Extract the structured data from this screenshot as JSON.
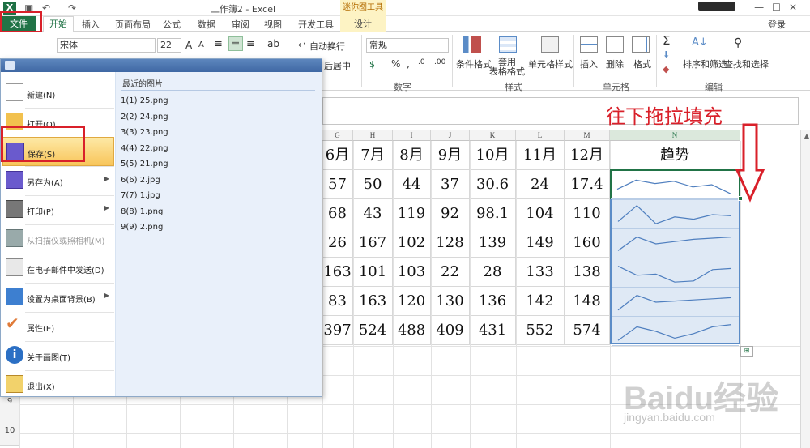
{
  "window": {
    "title": "工作簿2 - Excel",
    "context_tools_label": "迷你图工具",
    "minimize": "—",
    "restore": "☐",
    "close": "✕"
  },
  "tabs": {
    "file": "文件",
    "home": "开始",
    "insert": "插入",
    "page_layout": "页面布局",
    "formulas": "公式",
    "data": "数据",
    "review": "审阅",
    "view": "视图",
    "developer": "开发工具",
    "design": "设计",
    "login": "登录"
  },
  "ribbon": {
    "font_name": "宋体",
    "font_size": "22",
    "font_grow": "A",
    "font_shrink": "A",
    "wrap_text": "自动换行",
    "merge_center": "后居中",
    "number_format": "常规",
    "percent": "%",
    "comma": ",",
    "conditional_format": "条件格式",
    "table_format": "套用\n表格格式",
    "cell_styles": "单元格样式",
    "insert": "插入",
    "delete": "删除",
    "format": "格式",
    "sort_filter": "排序和筛选",
    "find_select": "查找和选择",
    "group_number": "数字",
    "group_styles": "样式",
    "group_cells": "单元格",
    "group_editing": "编辑"
  },
  "annotation": "往下拖拉填充",
  "file_menu": {
    "items": [
      {
        "label": "新建(N)"
      },
      {
        "label": "打开(O)"
      },
      {
        "label": "保存(S)"
      },
      {
        "label": "另存为(A)"
      },
      {
        "label": "打印(P)"
      },
      {
        "label": "从扫描仪或照相机(M)"
      },
      {
        "label": "在电子邮件中发送(D)"
      },
      {
        "label": "设置为桌面背景(B)"
      },
      {
        "label": "属性(E)"
      },
      {
        "label": "关于画图(T)"
      },
      {
        "label": "退出(X)"
      }
    ],
    "recent_title": "最近的图片",
    "recent": [
      {
        "num": "1(1)",
        "name": "25.png"
      },
      {
        "num": "2(2)",
        "name": "24.png"
      },
      {
        "num": "3(3)",
        "name": "23.png"
      },
      {
        "num": "4(4)",
        "name": "22.png"
      },
      {
        "num": "5(5)",
        "name": "21.png"
      },
      {
        "num": "6(6)",
        "name": "2.jpg"
      },
      {
        "num": "7(7)",
        "name": "1.jpg"
      },
      {
        "num": "8(8)",
        "name": "1.png"
      },
      {
        "num": "9(9)",
        "name": "2.png"
      }
    ],
    "submenu_arrow": "▶"
  },
  "sheet": {
    "columns": [
      "G",
      "H",
      "I",
      "J",
      "K",
      "L",
      "M",
      "N"
    ],
    "row_numbers": [
      "9",
      "10"
    ],
    "header_row": [
      "6月",
      "7月",
      "8月",
      "9月",
      "10月",
      "11月",
      "12月",
      "趋势"
    ],
    "rows": [
      [
        "57",
        "50",
        "44",
        "37",
        "30.6",
        "24",
        "17.4"
      ],
      [
        "68",
        "43",
        "119",
        "92",
        "98.1",
        "104",
        "110"
      ],
      [
        "26",
        "167",
        "102",
        "128",
        "139",
        "149",
        "160"
      ],
      [
        "163",
        "101",
        "103",
        "22",
        "28",
        "133",
        "138"
      ],
      [
        "83",
        "163",
        "120",
        "130",
        "136",
        "142",
        "148"
      ],
      [
        "397",
        "524",
        "488",
        "409",
        "431",
        "552",
        "574"
      ]
    ],
    "sparklines": [
      [
        0.7,
        0.3,
        0.45,
        0.35,
        0.6,
        0.5,
        0.9
      ],
      [
        0.8,
        0.1,
        0.9,
        0.6,
        0.7,
        0.5,
        0.55
      ],
      [
        0.8,
        0.2,
        0.5,
        0.4,
        0.3,
        0.25,
        0.2
      ],
      [
        0.2,
        0.6,
        0.55,
        0.9,
        0.85,
        0.35,
        0.3
      ],
      [
        0.85,
        0.2,
        0.5,
        0.45,
        0.4,
        0.35,
        0.3
      ],
      [
        0.9,
        0.3,
        0.5,
        0.8,
        0.6,
        0.3,
        0.2
      ]
    ],
    "quick_analysis_icon": "⊞"
  },
  "watermark": {
    "logo_text": "Baidu经验",
    "url": "jingyan.baidu.com"
  },
  "colors": {
    "excel_green": "#217346",
    "annotation_red": "#d9202a",
    "sparkline": "#4f7fbf",
    "selection_fill": "#dfe9f5"
  }
}
